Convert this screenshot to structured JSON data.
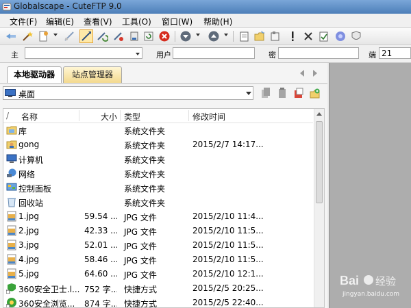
{
  "window": {
    "title": "Globalscape - CuteFTP 9.0"
  },
  "menu": {
    "items": [
      "文件(F)",
      "编辑(E)",
      "查看(V)",
      "工具(O)",
      "窗口(W)",
      "帮助(H)"
    ]
  },
  "quickconnect": {
    "host_label": "主",
    "host_value": "",
    "user_label": "用户",
    "user_value": "",
    "password_label": "密",
    "password_value": "",
    "port_label": "端",
    "port_value": "21"
  },
  "tabs": {
    "local": "本地驱动器",
    "site": "站点管理器"
  },
  "path": {
    "current": "桌面"
  },
  "columns": {
    "sort_marker": "/",
    "name": "名称",
    "size": "大小",
    "type": "类型",
    "modified": "修改时间"
  },
  "files": [
    {
      "icon": "library-folder-icon",
      "name": "库",
      "size": "",
      "type": "系统文件夹",
      "modified": ""
    },
    {
      "icon": "user-folder-icon",
      "name": "gong",
      "size": "",
      "type": "系统文件夹",
      "modified": "2015/2/7 14:17..."
    },
    {
      "icon": "computer-icon",
      "name": "计算机",
      "size": "",
      "type": "系统文件夹",
      "modified": ""
    },
    {
      "icon": "network-icon",
      "name": "网络",
      "size": "",
      "type": "系统文件夹",
      "modified": ""
    },
    {
      "icon": "control-panel-icon",
      "name": "控制面板",
      "size": "",
      "type": "系统文件夹",
      "modified": ""
    },
    {
      "icon": "recycle-bin-icon",
      "name": "回收站",
      "size": "",
      "type": "系统文件夹",
      "modified": ""
    },
    {
      "icon": "jpg-file-icon",
      "name": "1.jpg",
      "size": "59.54 ...",
      "type": "JPG 文件",
      "modified": "2015/2/10 11:4..."
    },
    {
      "icon": "jpg-file-icon",
      "name": "2.jpg",
      "size": "42.33 ...",
      "type": "JPG 文件",
      "modified": "2015/2/10 11:5..."
    },
    {
      "icon": "jpg-file-icon",
      "name": "3.jpg",
      "size": "52.01 ...",
      "type": "JPG 文件",
      "modified": "2015/2/10 11:5..."
    },
    {
      "icon": "jpg-file-icon",
      "name": "4.jpg",
      "size": "58.46 ...",
      "type": "JPG 文件",
      "modified": "2015/2/10 11:5..."
    },
    {
      "icon": "jpg-file-icon",
      "name": "5.jpg",
      "size": "64.60 ...",
      "type": "JPG 文件",
      "modified": "2015/2/10 12:1..."
    },
    {
      "icon": "shortcut-360-security-icon",
      "name": "360安全卫士.l...",
      "size": "752 字...",
      "type": "快捷方式",
      "modified": "2015/2/5 20:25..."
    },
    {
      "icon": "shortcut-360-browser-icon",
      "name": "360安全浏览...",
      "size": "874 字...",
      "type": "快捷方式",
      "modified": "2015/2/5 22:40..."
    }
  ],
  "watermark": {
    "brand": "Bai",
    "brand2": "经验",
    "url": "jingyan.baidu.com"
  },
  "colors": {
    "tab_active": "#ffffff",
    "tab_site": "#f3d98e",
    "right_pane": "#adadad",
    "titlebar": "#4d7fb9"
  }
}
